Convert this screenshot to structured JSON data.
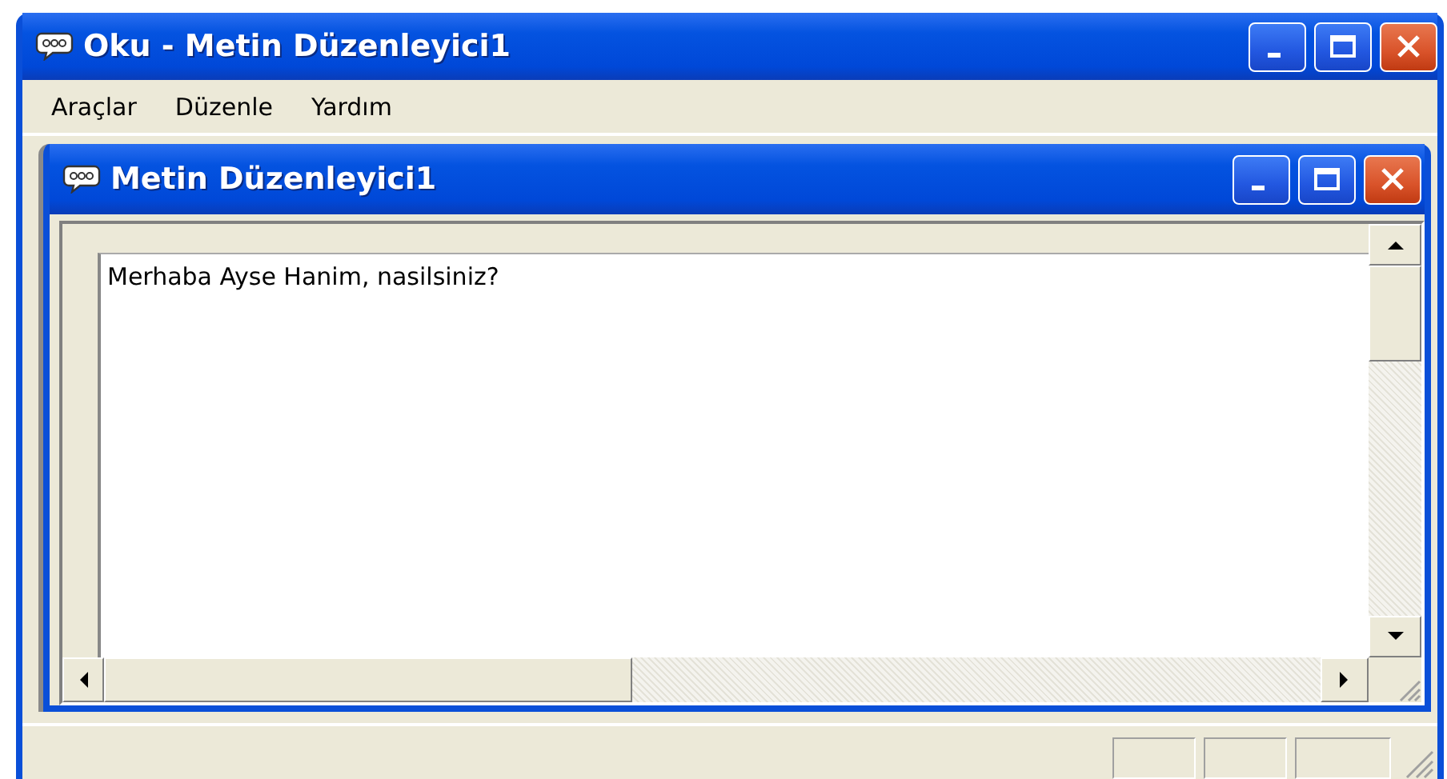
{
  "window": {
    "title": "Oku - Metin Düzenleyici1"
  },
  "menu": [
    {
      "label": "Araçlar"
    },
    {
      "label": "Düzenle"
    },
    {
      "label": "Yardım"
    }
  ],
  "child_window": {
    "title": "Metin Düzenleyici1",
    "text": "Merhaba Ayse Hanim, nasilsiniz?"
  }
}
